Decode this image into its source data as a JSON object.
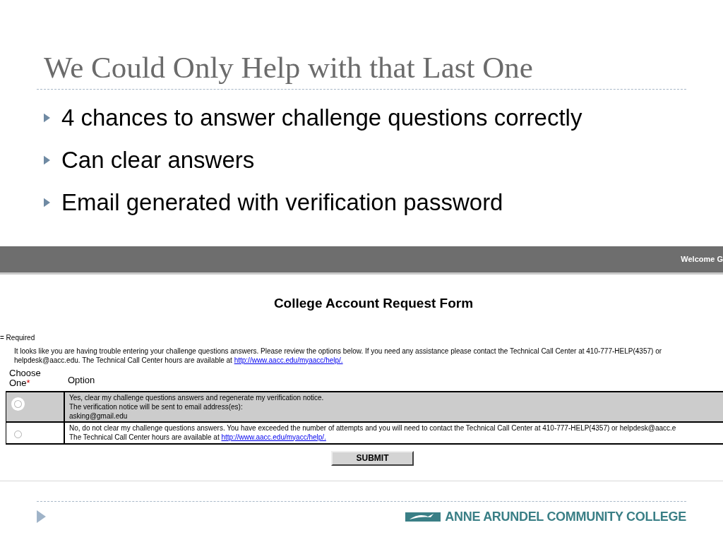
{
  "slide": {
    "title": "We Could Only Help with that Last One",
    "bullets": [
      "4 chances to answer challenge questions correctly",
      "Can clear answers",
      "Email generated with verification password"
    ],
    "footer": {
      "logo_text": "ANNE ARUNDEL COMMUNITY COLLEGE"
    }
  },
  "screenshot": {
    "header_bar": {
      "welcome": "Welcome G"
    },
    "form_title": "College Account Request Form",
    "required_note": "= Required",
    "intro": {
      "lines": [
        "It looks like you are having trouble entering your challenge questions answers. Please review the options below. If you need any assistance please contact the Technical Call Center at 410-777-HELP(4357) or",
        "helpdesk@aacc.edu. The Technical Call Center hours are available at"
      ],
      "link": "http://www.aacc.edu/myaacc/help/."
    },
    "table": {
      "columns": [
        {
          "label": "Choose One",
          "required_mark": "*"
        },
        {
          "label": "Option"
        }
      ],
      "rows": [
        {
          "selected": false,
          "highlighted": true,
          "lines": [
            "Yes, clear my challenge questions answers and regenerate my verification notice.",
            "The verification notice will be sent to email address(es):",
            "asking@gmail.edu"
          ]
        },
        {
          "selected": false,
          "highlighted": false,
          "lines": [
            "No, do not clear my challenge questions answers. You have exceeded the number of attempts and you will need to contact the Technical Call Center at 410-777-HELP(4357) or helpdesk@aacc.e",
            "The Technical Call Center hours are available at"
          ],
          "link": "http://www.aacc.edu/myacc/help/."
        }
      ]
    },
    "submit": "SUBMIT"
  }
}
